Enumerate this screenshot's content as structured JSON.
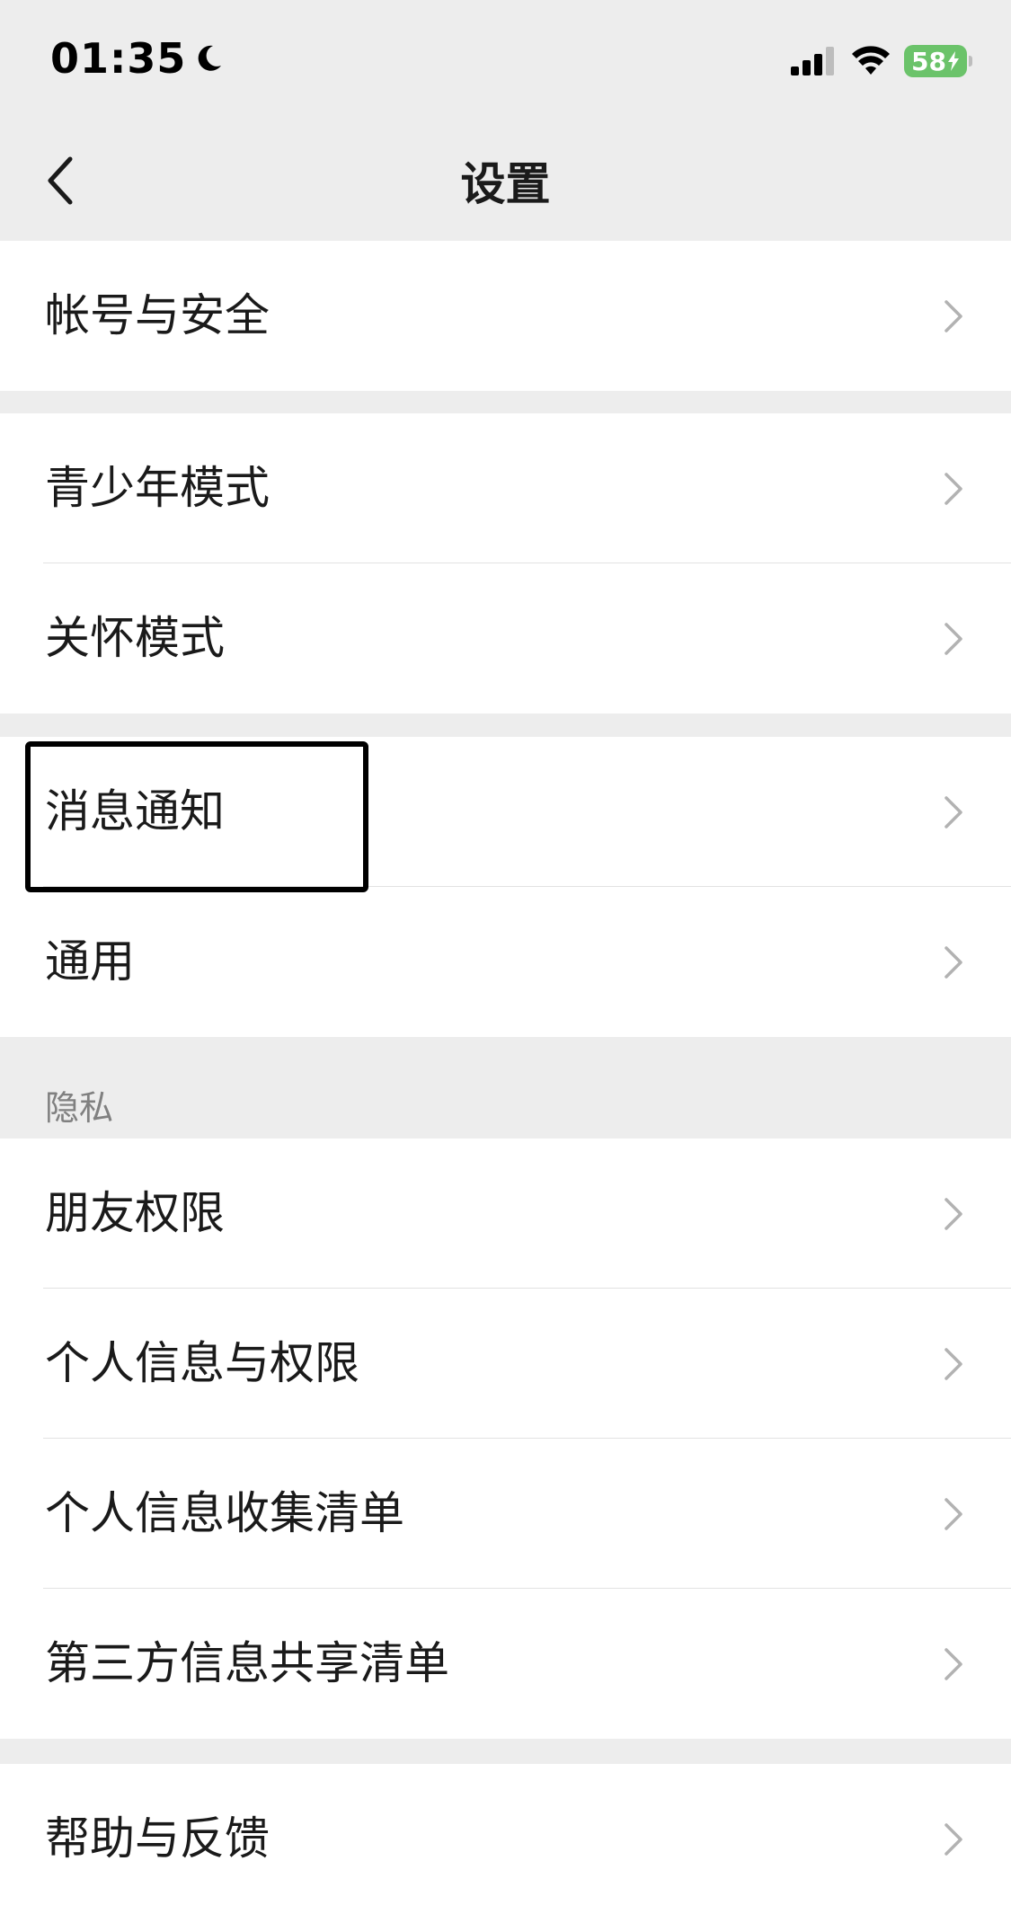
{
  "status_bar": {
    "time": "01:35",
    "battery_level": "58"
  },
  "nav": {
    "title": "设置"
  },
  "groups": [
    {
      "items": [
        {
          "label": "帐号与安全"
        }
      ]
    },
    {
      "items": [
        {
          "label": "青少年模式"
        },
        {
          "label": "关怀模式"
        }
      ]
    },
    {
      "items": [
        {
          "label": "消息通知"
        },
        {
          "label": "通用"
        }
      ]
    },
    {
      "header": "隐私",
      "items": [
        {
          "label": "朋友权限"
        },
        {
          "label": "个人信息与权限"
        },
        {
          "label": "个人信息收集清单"
        },
        {
          "label": "第三方信息共享清单"
        }
      ]
    },
    {
      "items": [
        {
          "label": "帮助与反馈"
        }
      ]
    }
  ],
  "colors": {
    "background": "#ededed",
    "card": "#ffffff",
    "battery": "#6bc36a",
    "chevron": "#b2b2b2"
  }
}
